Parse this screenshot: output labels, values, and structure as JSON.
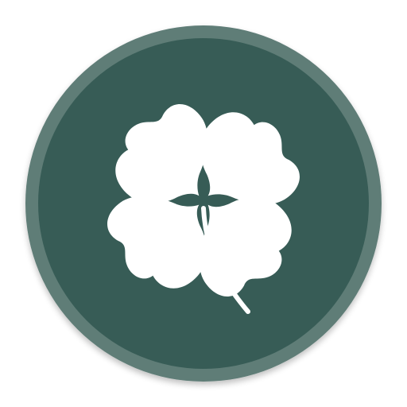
{
  "icon": {
    "name": "four-leaf-clover-icon",
    "colors": {
      "outer_ring": "#5f7d77",
      "inner_disc": "#375c56",
      "glyph": "#ffffff"
    }
  }
}
